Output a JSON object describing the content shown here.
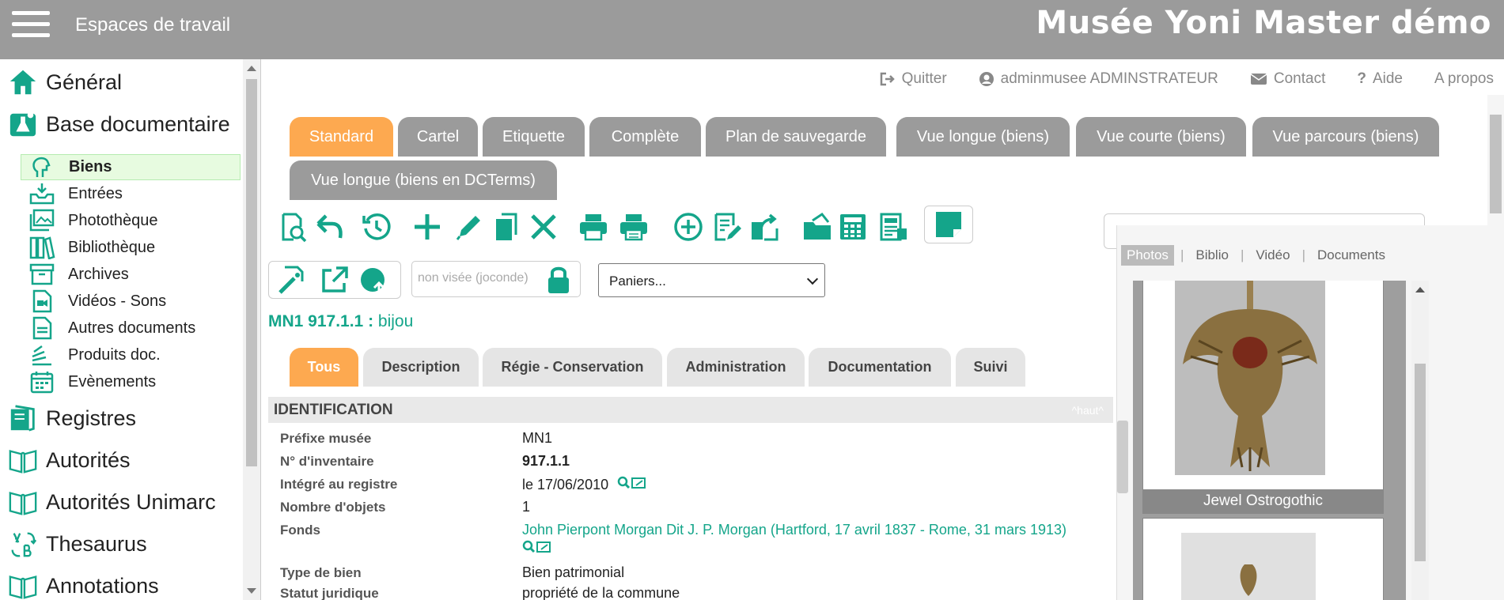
{
  "topbar": {
    "workspace_label": "Espaces de travail",
    "app_title": "Musée Yoni Master démo"
  },
  "sidebar": {
    "main_items": [
      {
        "label": "Général"
      },
      {
        "label": "Base documentaire"
      },
      {
        "label": "Registres"
      },
      {
        "label": "Autorités"
      },
      {
        "label": "Autorités Unimarc"
      },
      {
        "label": "Thesaurus"
      },
      {
        "label": "Annotations"
      }
    ],
    "sub_items": [
      {
        "label": "Biens"
      },
      {
        "label": "Entrées"
      },
      {
        "label": "Photothèque"
      },
      {
        "label": "Bibliothèque"
      },
      {
        "label": "Archives"
      },
      {
        "label": "Vidéos - Sons"
      },
      {
        "label": "Autres documents"
      },
      {
        "label": "Produits doc."
      },
      {
        "label": "Evènements"
      }
    ]
  },
  "header_links": {
    "quit": "Quitter",
    "user": "adminmusee ADMINSTRATEUR",
    "contact": "Contact",
    "help": "Aide",
    "about": "A propos"
  },
  "view_tabs": [
    {
      "label": "Standard"
    },
    {
      "label": "Cartel"
    },
    {
      "label": "Etiquette"
    },
    {
      "label": "Complète"
    },
    {
      "label": "Plan de sauvegarde"
    },
    {
      "label": "Vue longue (biens)"
    },
    {
      "label": "Vue courte (biens)"
    },
    {
      "label": "Vue parcours (biens)"
    },
    {
      "label": "Vue longue (biens en DCTerms)"
    }
  ],
  "visa_status": "non visée (joconde)",
  "basket_select": "Paniers...",
  "record": {
    "id": "MN1 917.1.1 :",
    "name": "bijou"
  },
  "section_tabs": [
    {
      "label": "Tous"
    },
    {
      "label": "Description"
    },
    {
      "label": "Régie - Conservation"
    },
    {
      "label": "Administration"
    },
    {
      "label": "Documentation"
    },
    {
      "label": "Suivi"
    }
  ],
  "section": {
    "title": "IDENTIFICATION",
    "top_link": "^haut^"
  },
  "fields": [
    {
      "label": "Préfixe musée",
      "value": "MN1"
    },
    {
      "label": "N° d'inventaire",
      "value": "917.1.1"
    },
    {
      "label": "Intégré au registre",
      "value": "le 17/06/2010"
    },
    {
      "label": "Nombre d'objets",
      "value": "1"
    },
    {
      "label": "Fonds",
      "value": "John Pierpont Morgan Dit J. P. Morgan (Hartford, 17 avril 1837 - Rome, 31 mars 1913)"
    },
    {
      "label": "Type de bien",
      "value": "Bien patrimonial"
    },
    {
      "label": "Statut juridique",
      "value": "propriété de la commune"
    }
  ],
  "media": {
    "tabs": [
      {
        "label": "Photos"
      },
      {
        "label": "Biblio"
      },
      {
        "label": "Vidéo"
      },
      {
        "label": "Documents"
      }
    ],
    "items": [
      {
        "caption": "Jewel Ostrogothic"
      }
    ]
  },
  "colors": {
    "accent": "#14a58a",
    "active_tab": "#fda950",
    "tab": "#9b9b9b",
    "topbar": "#9b9b9b"
  }
}
